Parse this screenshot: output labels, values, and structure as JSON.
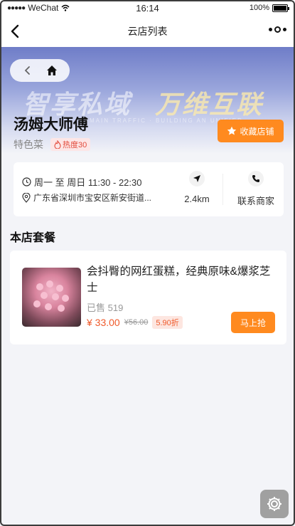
{
  "status_bar": {
    "carrier": "WeChat",
    "time": "16:14",
    "battery": "100%",
    "battery_level": 1.0
  },
  "nav": {
    "title": "云店列表"
  },
  "banner": {
    "text_left": "智享私域",
    "text_right": "万维互联",
    "subtitle": "DOMAIN TRAFFIC · BUILDING AN UNIFIED ..."
  },
  "shop": {
    "name": "汤姆大师傅",
    "category": "特色菜",
    "heat_label": "热度30",
    "favorite_label": "收藏店铺",
    "hours": "周一 至 周日 11:30 - 22:30",
    "address": "广东省深圳市宝安区新安街道...",
    "distance": "2.4km",
    "contact_label": "联系商家"
  },
  "section": {
    "title": "本店套餐"
  },
  "product": {
    "title": "会抖臀的网红蛋糕，经典原味&爆浆芝士",
    "sold": "已售 519",
    "price": "¥ 33.00",
    "original_price": "¥56.00",
    "discount": "5.90折",
    "buy_label": "马上抢"
  },
  "colors": {
    "accent": "#ff8a1f",
    "price": "#ef5a2b",
    "heat": "#e24a3b"
  },
  "icons": [
    "back-icon",
    "more-icon",
    "home-icon",
    "star-icon",
    "flame-icon",
    "clock-icon",
    "location-icon",
    "navigation-icon",
    "phone-icon",
    "gear-icon"
  ]
}
